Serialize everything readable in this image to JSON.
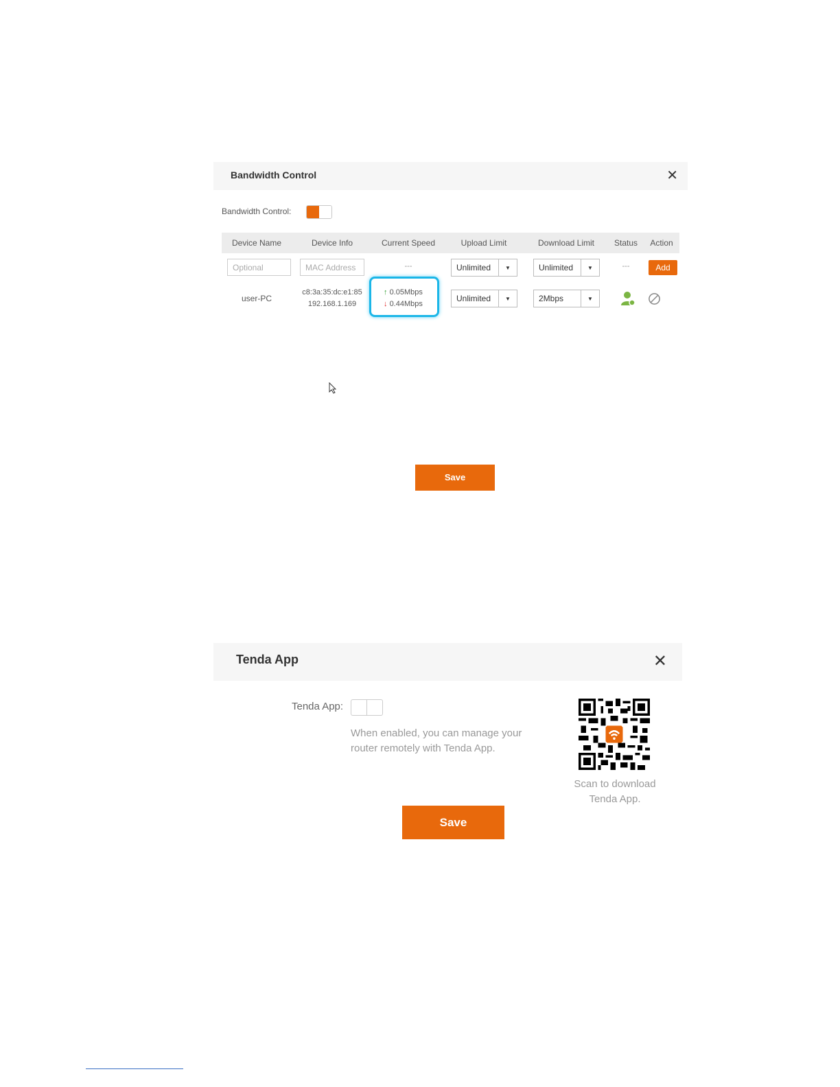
{
  "bandwidth": {
    "title": "Bandwidth Control",
    "close_icon": "close-icon",
    "toggle_label": "Bandwidth Control:",
    "toggle_on": true,
    "columns": [
      "Device Name",
      "Device Info",
      "Current Speed",
      "Upload Limit",
      "Download Limit",
      "Status",
      "Action"
    ],
    "new_row": {
      "name_placeholder": "Optional",
      "mac_placeholder": "MAC Address",
      "speed": "---",
      "upload": "Unlimited",
      "download": "Unlimited",
      "status": "---",
      "action": "Add"
    },
    "device": {
      "name": "user-PC",
      "mac": "c8:3a:35:dc:e1:85",
      "ip": "192.168.1.169",
      "upload_speed": "0.05Mbps",
      "download_speed": "0.44Mbps",
      "upload_limit": "Unlimited",
      "download_limit": "2Mbps",
      "status_icon": "user-online-icon",
      "action_icon": "block-icon"
    },
    "save": "Save",
    "accent": "#e8690c",
    "highlight": "#1ab6e8"
  },
  "tenda_app": {
    "title": "Tenda App",
    "close_icon": "close-icon",
    "label": "Tenda App:",
    "toggle_on": false,
    "description": "When enabled, you can manage your router remotely with Tenda App.",
    "qr_icon": "qr-code-icon",
    "qr_caption": "Scan to download Tenda App.",
    "save": "Save"
  }
}
